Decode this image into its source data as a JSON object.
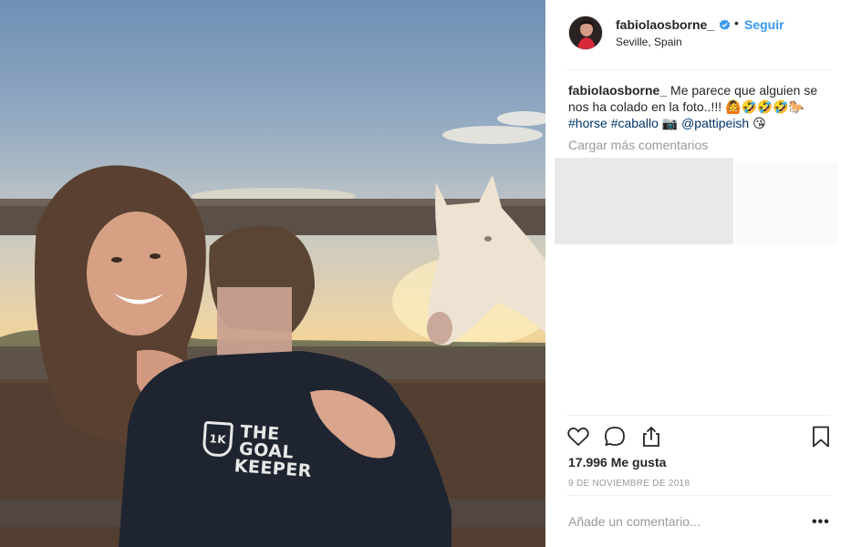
{
  "post": {
    "image_alt": "Photo",
    "shirt_text_line1": "THE",
    "shirt_text_line2": "GOAL",
    "shirt_text_line3": "KEEPER"
  },
  "header": {
    "username": "fabiolaosborne_",
    "separator": "•",
    "follow_label": "Seguir",
    "location": "Seville, Spain",
    "verified_icon": "verified-badge-icon"
  },
  "caption": {
    "username": "fabiolaosborne_",
    "text": "Me parece que alguien se nos ha colado en la foto..!!! 🙆🤣🤣🤣🐎",
    "hashtag1": "#horse",
    "hashtag2": "#caballo",
    "emoji_camera": "📷",
    "mention": "@pattipeish",
    "emoji_kiss": "😘"
  },
  "comments": {
    "load_more_label": "Cargar más comentarios"
  },
  "actions": {
    "like_icon": "heart-icon",
    "comment_icon": "comment-icon",
    "share_icon": "share-icon",
    "save_icon": "bookmark-icon"
  },
  "stats": {
    "likes_text": "17.996 Me gusta",
    "date": "9 DE NOVIEMBRE DE 2018"
  },
  "comment_box": {
    "placeholder": "Añade un comentario...",
    "more_label": "•••"
  },
  "colors": {
    "link_blue": "#3897f0",
    "hashtag_blue": "#003569",
    "muted_gray": "#999999"
  }
}
